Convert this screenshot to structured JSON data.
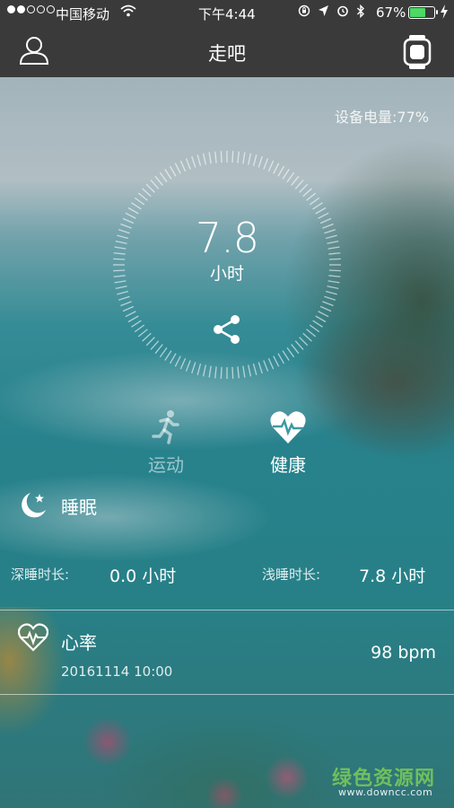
{
  "status_bar": {
    "carrier": "中国移动",
    "time": "下午4:44",
    "battery_percent": "67%",
    "battery_level": 0.67,
    "signal_bars": 2,
    "icons": [
      "wifi-icon",
      "rotation-lock-icon",
      "location-icon",
      "alarm-icon",
      "bluetooth-icon",
      "charging-icon"
    ]
  },
  "nav": {
    "title": "走吧",
    "left_icon": "user-icon",
    "right_icon": "watch-icon"
  },
  "device": {
    "battery_text": "设备电量:77%"
  },
  "dial": {
    "value": "7.8",
    "unit": "小时",
    "share_icon": "share-icon"
  },
  "modes": [
    {
      "label": "运动",
      "icon": "running-icon",
      "active": false
    },
    {
      "label": "健康",
      "icon": "heart-pulse-icon",
      "active": true
    }
  ],
  "sleep": {
    "title": "睡眠",
    "icon": "moon-star-icon",
    "deep_label": "深睡时长:",
    "deep_value": "0.0 小时",
    "light_label": "浅睡时长:",
    "light_value": "7.8 小时"
  },
  "heart_rate": {
    "title": "心率",
    "icon": "heart-rate-icon",
    "date": "20161114 10:00",
    "value": "98 bpm"
  },
  "watermark": {
    "text": "绿色资源网",
    "url": "www.downcc.com"
  },
  "colors": {
    "topbar": "#3a3a3a",
    "battery_fill": "#4cd964",
    "watermark": "#78c85a"
  }
}
